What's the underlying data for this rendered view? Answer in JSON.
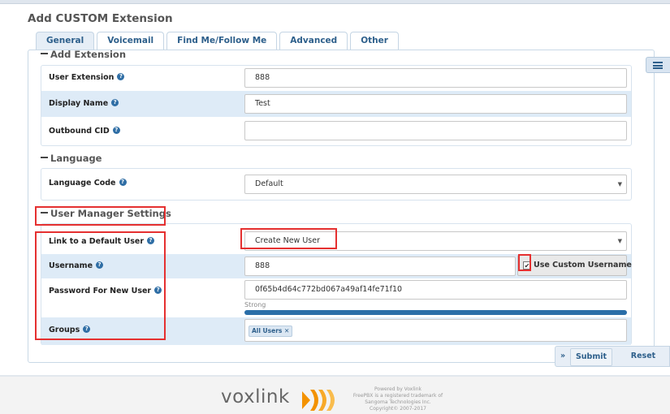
{
  "page": {
    "title": "Add CUSTOM Extension",
    "tabs": [
      "General",
      "Voicemail",
      "Find Me/Follow Me",
      "Advanced",
      "Other"
    ],
    "active_tab": "General"
  },
  "sections": {
    "add_extension": {
      "title": "Add Extension",
      "user_extension": {
        "label": "User Extension",
        "value": "888"
      },
      "display_name": {
        "label": "Display Name",
        "value": "Test"
      },
      "outbound_cid": {
        "label": "Outbound CID",
        "value": ""
      }
    },
    "language": {
      "title": "Language",
      "language_code": {
        "label": "Language Code",
        "value": "Default"
      }
    },
    "user_manager": {
      "title": "User Manager Settings",
      "link_default_user": {
        "label": "Link to a Default User",
        "value": "Create New User"
      },
      "username": {
        "label": "Username",
        "value": "888",
        "custom_label": "Use Custom Username",
        "custom_checked": true
      },
      "password": {
        "label": "Password For New User",
        "value": "0f65b4d64c772bd067a49af14fe71f10",
        "strength_label": "Strong",
        "strength": 1.0
      },
      "groups": {
        "label": "Groups",
        "tags": [
          "All Users"
        ]
      }
    }
  },
  "actions": {
    "submit": "Submit",
    "reset": "Reset"
  },
  "footer": {
    "logo_text": "voxlink",
    "lines": [
      "Powered by Voxlink",
      "FreePBX is a registered trademark of",
      "Sangoma Technologies Inc.",
      "Copyright© 2007-2017"
    ]
  },
  "colors": {
    "accent": "#2d5f8b",
    "row_highlight": "#deebf7",
    "annotation": "#e53030",
    "logo_orange": "#f39200"
  },
  "icons": {
    "help": "question-circle-icon",
    "caret": "caret-down-icon",
    "list": "list-icon",
    "chevron": "double-chevron-right-icon"
  }
}
